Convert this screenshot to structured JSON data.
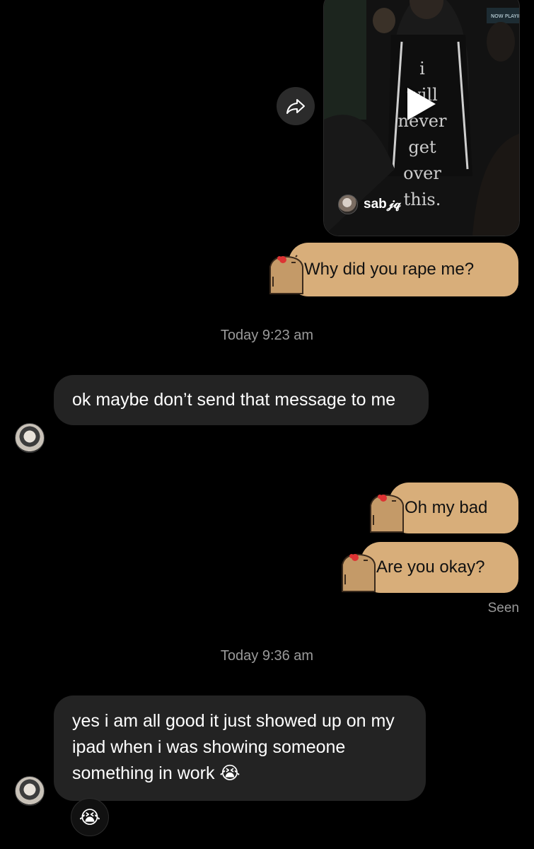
{
  "video_message": {
    "overlay_lines": [
      "i",
      "will",
      "never",
      "get",
      "over",
      "this."
    ],
    "author": "sab𝒿𝓆",
    "sign_text": "NOW PLAYIN"
  },
  "messages": {
    "sent_1": "Why did you rape me?",
    "timestamp_1": "Today 9:23 am",
    "received_1": "ok maybe don’t send that message to me",
    "sent_2": "Oh my bad",
    "sent_3": "Are you okay?",
    "seen_label": "Seen",
    "timestamp_2": "Today 9:36 am",
    "received_2": "yes i am all good it just showed up on my ipad when i was showing someone something in work 😭",
    "reaction_emoji": "😭"
  },
  "colors": {
    "background": "#000000",
    "sent_bubble": "#d8ae7a",
    "received_bubble": "#232323",
    "muted_text": "#9a9a9a"
  },
  "icons": {
    "share": "share-arrow-icon",
    "play": "play-icon",
    "sticker": "capybara-sticker-icon"
  }
}
